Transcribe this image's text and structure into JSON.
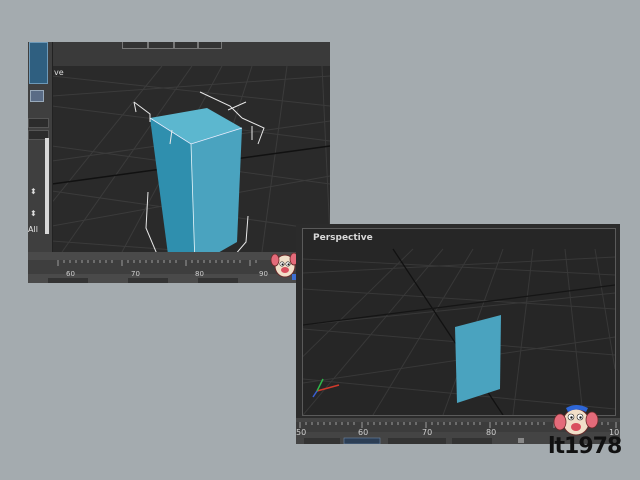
{
  "screenshot_top_left": {
    "viewport_label": "ve",
    "side_panel": {
      "all_label": "All",
      "spinner_glyph": "⬍"
    },
    "timeline": {
      "ticks": [
        "60",
        "70",
        "80",
        "90"
      ]
    },
    "object": {
      "shape": "box",
      "color": "#4aa3bf",
      "selected": true
    }
  },
  "screenshot_bottom_right": {
    "viewport_label": "Perspective",
    "timeline": {
      "ticks": [
        "50",
        "60",
        "70",
        "80",
        "10"
      ]
    },
    "object": {
      "shape": "plane",
      "color": "#4aa3bf"
    },
    "axis_colors": {
      "x": "#d03a2c",
      "y": "#2fb84a",
      "z": "#3a5fd0"
    }
  },
  "watermark": {
    "text": "lt1978"
  },
  "colors": {
    "background": "#a4abaf",
    "viewport": "#2a2a2a",
    "grid": "#3b3b3b",
    "selection_bracket": "#e8e8e8",
    "object": "#4aa3bf"
  }
}
